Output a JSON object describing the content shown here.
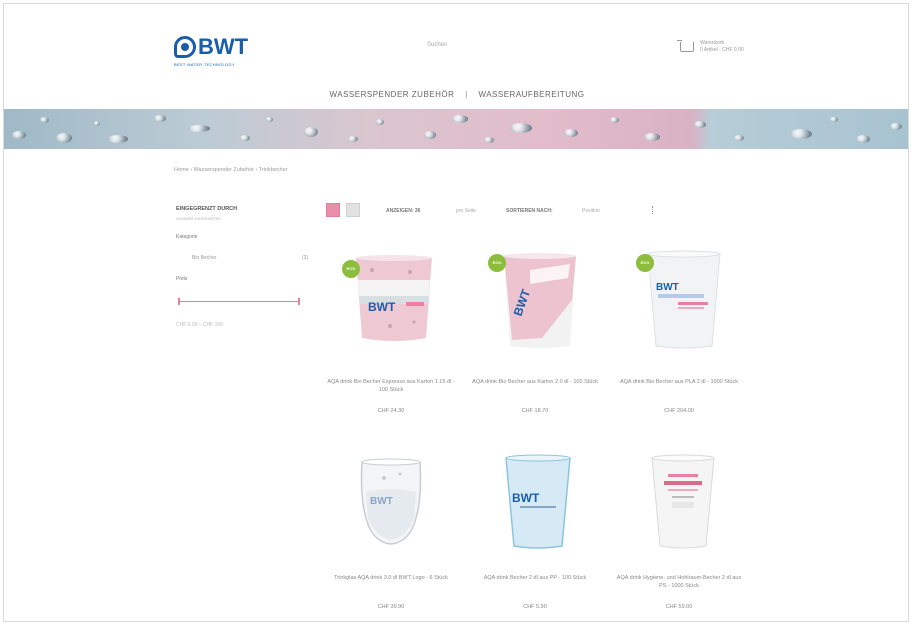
{
  "header": {
    "logo_text": "BWT",
    "logo_tagline": "BEST WATER TECHNOLOGY",
    "search_placeholder": "Suchen",
    "cart_line1": "Warenkorb",
    "cart_line2": "0 Artikel · CHF 0.00"
  },
  "nav": {
    "items": [
      "WASSERSPENDER ZUBEHÖR",
      "WASSERAUFBEREITUNG"
    ],
    "separator": "|"
  },
  "breadcrumb": "Home › Wasserspender Zubehör › Trinkbecher",
  "sidebar": {
    "title": "EINGEGRENZT DURCH",
    "subtitle": "Auswahl zurücksetzen",
    "group_label": "Kategorie",
    "option_label": "Bio Becher",
    "option_count": "(3)",
    "price_label": "Preis",
    "price_range": "CHF 0.00 – CHF 100"
  },
  "toolbar": {
    "per_page_label": "ANZEIGEN: 36",
    "per_page_suffix": "pro Seite",
    "sort_label": "SORTIEREN NACH:",
    "sort_value": "Position"
  },
  "products": [
    {
      "name": "AQA drink Bio Becher Espresso aus Karton 1.15 dl - 100 Stück",
      "price": "CHF 24.30",
      "eco": true,
      "badge": "ECO"
    },
    {
      "name": "AQA drink Bio Becher aus Karton 2.0 dl - 100 Stück",
      "price": "CHF 18.70",
      "eco": true,
      "badge": "ECO"
    },
    {
      "name": "AQA drink Bio Becher aus PLA 2 dl - 1000 Stück",
      "price": "CHF 204.00",
      "eco": true,
      "badge": "ECO"
    },
    {
      "name": "Trinkglas AQA drink 3.0 dl BWT Logo - 6 Stück",
      "price": "CHF 39.90",
      "eco": false
    },
    {
      "name": "AQA drink Becher 2 dl aus PP - 100 Stück",
      "price": "CHF 5.90",
      "eco": false
    },
    {
      "name": "AQA drink Hygiene- und Hohlraum-Becher 2 dl aus PS - 1000 Stück",
      "price": "CHF 59.00",
      "eco": false
    }
  ],
  "colors": {
    "brand_blue": "#1a5eab",
    "accent_pink": "#e9809f",
    "eco_green": "#8dbd3c"
  }
}
